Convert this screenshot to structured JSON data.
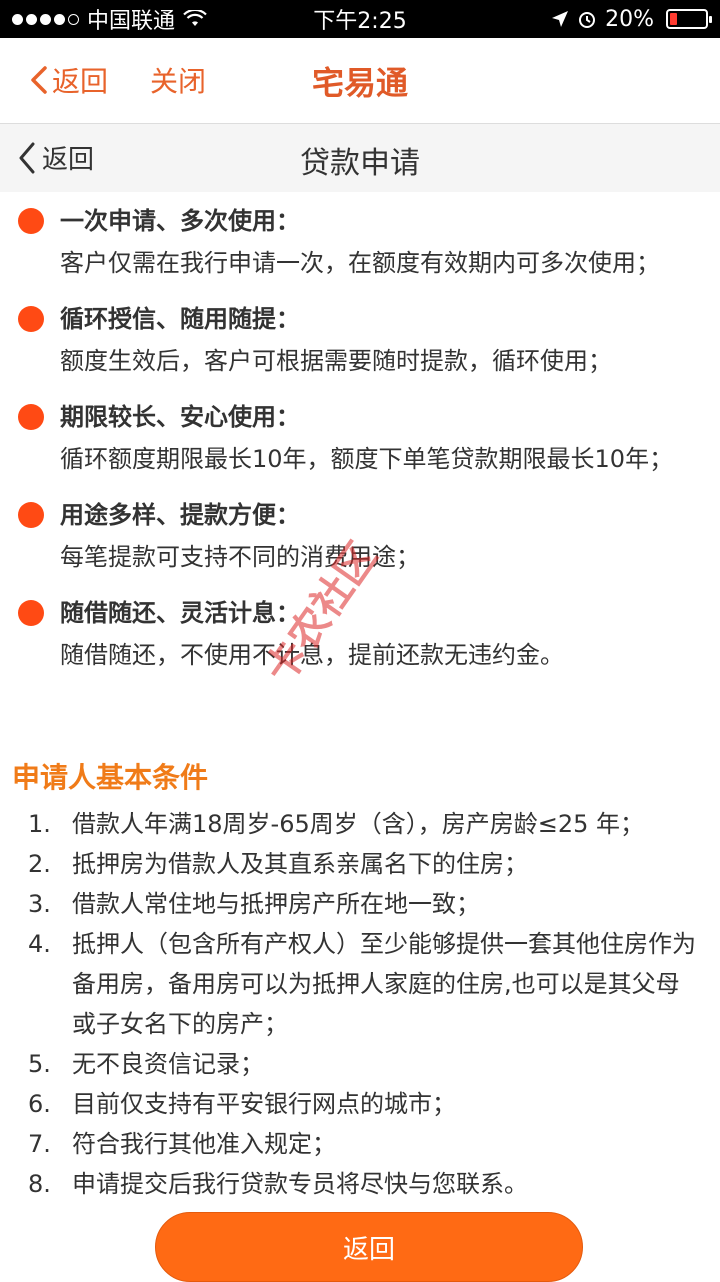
{
  "status_bar": {
    "carrier": "中国联通",
    "time": "下午2:25",
    "battery_percent": "20%",
    "battery_level": 0.2,
    "signal_dots": 5,
    "signal_filled": 4
  },
  "app_header": {
    "back_label": "返回",
    "close_label": "关闭",
    "title": "宅易通",
    "accent_color": "#e8632b"
  },
  "sub_header": {
    "back_label": "返回",
    "title": "贷款申请"
  },
  "features": [
    {
      "title": "一次申请、多次使用：",
      "desc": "客户仅需在我行申请一次，在额度有效期内可多次使用；"
    },
    {
      "title": "循环授信、随用随提：",
      "desc": "额度生效后，客户可根据需要随时提款，循环使用；"
    },
    {
      "title": "期限较长、安心使用：",
      "desc": "循环额度期限最长10年，额度下单笔贷款期限最长10年；"
    },
    {
      "title": "用途多样、提款方便：",
      "desc": "每笔提款可支持不同的消费用途；"
    },
    {
      "title": "随借随还、灵活计息：",
      "desc": "随借随还，不使用不计息，提前还款无违约金。"
    }
  ],
  "conditions": {
    "title": "申请人基本条件",
    "items": [
      {
        "num": "1.",
        "text": "借款人年满18周岁-65周岁（含），房产房龄≤25 年；"
      },
      {
        "num": "2.",
        "text": "抵押房为借款人及其直系亲属名下的住房；"
      },
      {
        "num": "3.",
        "text": "借款人常住地与抵押房产所在地一致；"
      },
      {
        "num": "4.",
        "text": "抵押人（包含所有产权人）至少能够提供一套其他住房作为备用房，备用房可以为抵押人家庭的住房,也可以是其父母或子女名下的房产；"
      },
      {
        "num": "5.",
        "text": "无不良资信记录；"
      },
      {
        "num": "6.",
        "text": "目前仅支持有平安银行网点的城市；"
      },
      {
        "num": "7.",
        "text": "符合我行其他准入规定；"
      },
      {
        "num": "8.",
        "text": "申请提交后我行贷款专员将尽快与您联系。"
      }
    ]
  },
  "bottom_button": {
    "label": "返回",
    "color": "#ff6a14"
  },
  "watermark": {
    "text": "卡农社区"
  },
  "icons": {
    "back_chevron": "chevron-left-icon",
    "bullet": "bullet-dot-icon",
    "wifi": "wifi-icon",
    "location": "location-arrow-icon",
    "alarm": "alarm-icon",
    "battery": "battery-icon"
  }
}
